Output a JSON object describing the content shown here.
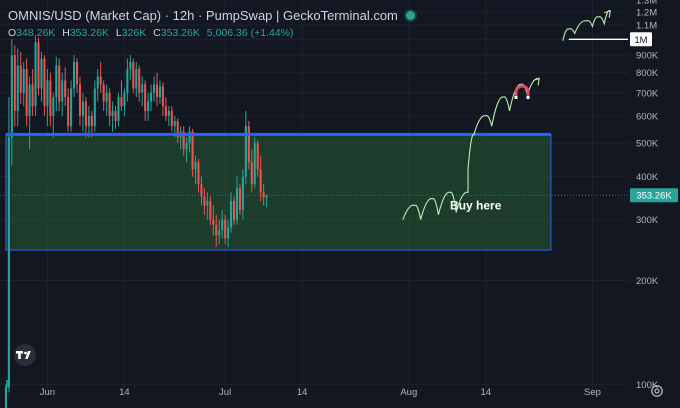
{
  "header": {
    "title": "OMNIS/USD (Market Cap) · 12h · PumpSwap | GeckoTerminal.com",
    "ohlc": [
      {
        "k": "O",
        "v": "348.26K"
      },
      {
        "k": "H",
        "v": "353.26K"
      },
      {
        "k": "L",
        "v": "326K"
      },
      {
        "k": "C",
        "v": "353.26K"
      }
    ],
    "change": "5,006.36 (+1.44%)"
  },
  "colors": {
    "background": "#131722",
    "up": "#26a69a",
    "down": "#ef5350",
    "resistance": "#2962ff",
    "zone": "#2b6a3a",
    "arrow": "#b8f0b0"
  },
  "icons": [
    "tradingview-logo-icon",
    "status-dot-icon",
    "magnet-icon",
    "settings-icon"
  ],
  "chart_data": {
    "type": "candlestick",
    "y_scale": "log",
    "ylim": [
      95000,
      1300000
    ],
    "y_ticks": [
      {
        "v": 1300000,
        "label": "1.3M"
      },
      {
        "v": 1200000,
        "label": "1.2M"
      },
      {
        "v": 1100000,
        "label": "1.1M"
      },
      {
        "v": 1000000,
        "label": "1M"
      },
      {
        "v": 900000,
        "label": "900K"
      },
      {
        "v": 800000,
        "label": "800K"
      },
      {
        "v": 700000,
        "label": "700K"
      },
      {
        "v": 600000,
        "label": "600K"
      },
      {
        "v": 500000,
        "label": "500K"
      },
      {
        "v": 400000,
        "label": "400K"
      },
      {
        "v": 300000,
        "label": "300K"
      },
      {
        "v": 200000,
        "label": "200K"
      },
      {
        "v": 100000,
        "label": "100K"
      }
    ],
    "xlim": [
      "2025-05-24",
      "2025-09-07"
    ],
    "x_ticks": [
      {
        "date": "2025-06-01",
        "label": "Jun"
      },
      {
        "date": "2025-06-14",
        "label": "14"
      },
      {
        "date": "2025-07-01",
        "label": "Jul"
      },
      {
        "date": "2025-07-14",
        "label": "14"
      },
      {
        "date": "2025-08-01",
        "label": "Aug"
      },
      {
        "date": "2025-08-14",
        "label": "14"
      },
      {
        "date": "2025-09-01",
        "label": "Sep"
      }
    ],
    "first_candle": "2025-05-25",
    "candles_per_day": 2,
    "candles": [
      [
        80000,
        100000,
        78000,
        98000
      ],
      [
        98000,
        680000,
        95000,
        520000
      ],
      [
        520000,
        1000000,
        430000,
        900000
      ],
      [
        900000,
        960000,
        560000,
        620000
      ],
      [
        620000,
        940000,
        560000,
        840000
      ],
      [
        840000,
        920000,
        650000,
        700000
      ],
      [
        700000,
        860000,
        640000,
        820000
      ],
      [
        820000,
        880000,
        560000,
        600000
      ],
      [
        600000,
        780000,
        480000,
        740000
      ],
      [
        740000,
        820000,
        600000,
        640000
      ],
      [
        640000,
        1020000,
        600000,
        980000
      ],
      [
        980000,
        1010000,
        690000,
        720000
      ],
      [
        720000,
        920000,
        660000,
        880000
      ],
      [
        880000,
        900000,
        600000,
        640000
      ],
      [
        640000,
        820000,
        560000,
        760000
      ],
      [
        760000,
        800000,
        560000,
        600000
      ],
      [
        600000,
        700000,
        520000,
        680000
      ],
      [
        680000,
        890000,
        620000,
        840000
      ],
      [
        840000,
        880000,
        620000,
        660000
      ],
      [
        660000,
        800000,
        600000,
        760000
      ],
      [
        760000,
        830000,
        640000,
        680000
      ],
      [
        680000,
        720000,
        540000,
        560000
      ],
      [
        560000,
        760000,
        540000,
        720000
      ],
      [
        720000,
        900000,
        680000,
        860000
      ],
      [
        860000,
        880000,
        700000,
        740000
      ],
      [
        740000,
        780000,
        560000,
        600000
      ],
      [
        600000,
        700000,
        540000,
        660000
      ],
      [
        660000,
        680000,
        520000,
        560000
      ],
      [
        560000,
        640000,
        520000,
        600000
      ],
      [
        600000,
        620000,
        520000,
        560000
      ],
      [
        560000,
        760000,
        540000,
        720000
      ],
      [
        720000,
        820000,
        660000,
        780000
      ],
      [
        780000,
        860000,
        700000,
        740000
      ],
      [
        740000,
        760000,
        620000,
        660000
      ],
      [
        660000,
        740000,
        600000,
        700000
      ],
      [
        700000,
        720000,
        560000,
        600000
      ],
      [
        600000,
        660000,
        540000,
        620000
      ],
      [
        620000,
        640000,
        550000,
        580000
      ],
      [
        580000,
        700000,
        560000,
        680000
      ],
      [
        680000,
        760000,
        620000,
        640000
      ],
      [
        640000,
        720000,
        600000,
        700000
      ],
      [
        700000,
        880000,
        660000,
        820000
      ],
      [
        820000,
        900000,
        760000,
        860000
      ],
      [
        860000,
        880000,
        700000,
        720000
      ],
      [
        720000,
        860000,
        680000,
        820000
      ],
      [
        820000,
        840000,
        660000,
        700000
      ],
      [
        700000,
        780000,
        640000,
        740000
      ],
      [
        740000,
        760000,
        580000,
        620000
      ],
      [
        620000,
        700000,
        580000,
        660000
      ],
      [
        660000,
        740000,
        620000,
        700000
      ],
      [
        700000,
        780000,
        660000,
        740000
      ],
      [
        740000,
        800000,
        640000,
        680000
      ],
      [
        680000,
        760000,
        650000,
        730000
      ],
      [
        730000,
        750000,
        600000,
        640000
      ],
      [
        640000,
        680000,
        580000,
        600000
      ],
      [
        600000,
        640000,
        560000,
        620000
      ],
      [
        620000,
        640000,
        540000,
        560000
      ],
      [
        560000,
        600000,
        520000,
        580000
      ],
      [
        580000,
        590000,
        500000,
        520000
      ],
      [
        520000,
        560000,
        480000,
        540000
      ],
      [
        540000,
        560000,
        460000,
        480000
      ],
      [
        480000,
        520000,
        440000,
        500000
      ],
      [
        500000,
        560000,
        470000,
        540000
      ],
      [
        540000,
        550000,
        400000,
        420000
      ],
      [
        420000,
        460000,
        380000,
        440000
      ],
      [
        440000,
        450000,
        360000,
        380000
      ],
      [
        380000,
        400000,
        330000,
        350000
      ],
      [
        350000,
        370000,
        310000,
        330000
      ],
      [
        330000,
        360000,
        300000,
        340000
      ],
      [
        340000,
        350000,
        290000,
        300000
      ],
      [
        300000,
        330000,
        270000,
        290000
      ],
      [
        290000,
        310000,
        250000,
        270000
      ],
      [
        270000,
        300000,
        255000,
        280000
      ],
      [
        280000,
        320000,
        265000,
        300000
      ],
      [
        300000,
        310000,
        255000,
        265000
      ],
      [
        265000,
        300000,
        250000,
        285000
      ],
      [
        285000,
        360000,
        275000,
        340000
      ],
      [
        340000,
        350000,
        290000,
        300000
      ],
      [
        300000,
        400000,
        290000,
        370000
      ],
      [
        370000,
        380000,
        310000,
        320000
      ],
      [
        320000,
        420000,
        300000,
        400000
      ],
      [
        400000,
        620000,
        380000,
        560000
      ],
      [
        560000,
        580000,
        420000,
        440000
      ],
      [
        440000,
        480000,
        360000,
        380000
      ],
      [
        380000,
        520000,
        370000,
        500000
      ],
      [
        500000,
        510000,
        400000,
        420000
      ],
      [
        420000,
        460000,
        340000,
        360000
      ],
      [
        360000,
        380000,
        330000,
        348260
      ],
      [
        348260,
        353260,
        326000,
        353260
      ]
    ],
    "resistance_level": 530000,
    "zone": {
      "from": "2025-05-25",
      "to": "2025-08-25",
      "low": 245000,
      "high": 530000
    },
    "price_label": "353.26K",
    "target_level": 1000000,
    "target_label": "1M",
    "annotations": [
      {
        "text": "Buy here",
        "date": "2025-08-11",
        "value": 330000
      }
    ]
  }
}
